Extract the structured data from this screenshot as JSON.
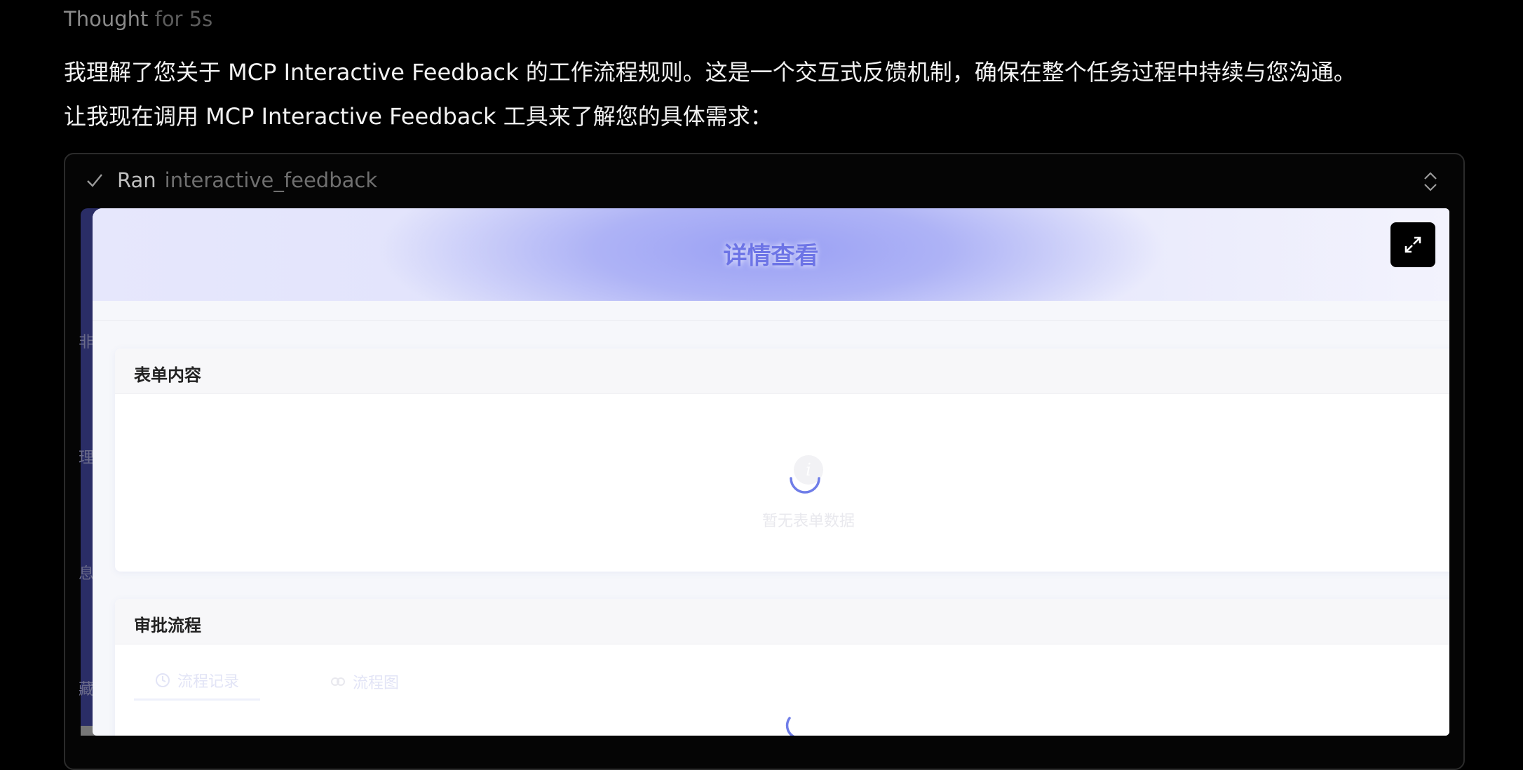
{
  "thought": {
    "label": "Thought",
    "duration": "for 5s"
  },
  "messages": [
    "我理解了您关于 MCP Interactive Feedback 的工作流程规则。这是一个交互式反馈机制，确保在整个任务过程中持续与您沟通。",
    "让我现在调用 MCP Interactive Feedback 工具来了解您的具体需求："
  ],
  "tool": {
    "status_icon": "check-icon",
    "status": "Ran",
    "name": "interactive_feedback",
    "expand_icon": "chevron-up-down-icon"
  },
  "side_chars": [
    "非",
    "理",
    "息",
    "藏"
  ],
  "panel": {
    "title": "详情查看",
    "fullscreen_icon": "expand-arrows-icon",
    "accent": "#6d74e6",
    "sections": [
      {
        "title": "表单内容",
        "empty_text": "暂无表单数据",
        "loading": true
      },
      {
        "title": "审批流程",
        "tabs": [
          {
            "label": "流程记录",
            "icon": "clock-icon",
            "active": true
          },
          {
            "label": "流程图",
            "icon": "flow-icon",
            "active": false
          }
        ],
        "loading": true
      }
    ]
  }
}
